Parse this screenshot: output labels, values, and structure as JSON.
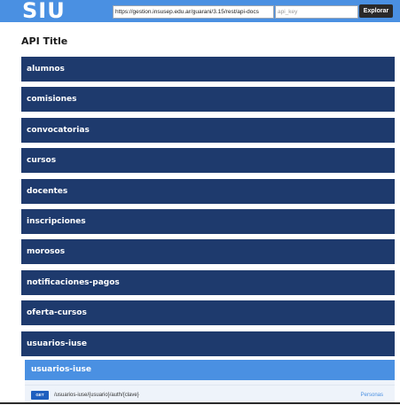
{
  "header": {
    "logo_text": "SIU",
    "url_value": "https://gestion.insusep.edu.ar/guarani/3.15/rest/api-docs",
    "api_key_placeholder": "api_key",
    "explore_label": "Explorar",
    "accent_color": "#4a90e2",
    "button_color": "#2a2a2a"
  },
  "main": {
    "title": "API Title",
    "resources": [
      {
        "label": "alumnos"
      },
      {
        "label": "comisiones"
      },
      {
        "label": "convocatorias"
      },
      {
        "label": "cursos"
      },
      {
        "label": "docentes"
      },
      {
        "label": "inscripciones"
      },
      {
        "label": "morosos"
      },
      {
        "label": "notificaciones-pagos"
      },
      {
        "label": "oferta-cursos"
      },
      {
        "label": "usuarios-iuse"
      }
    ],
    "resource_color": "#1e3a6d",
    "expanded": {
      "label": "usuarios-iuse",
      "operations": [
        {
          "method": "GET",
          "path": "/usuarios-iuse/{usuario}/auth/{clave}",
          "summary": "Personas"
        }
      ]
    }
  }
}
